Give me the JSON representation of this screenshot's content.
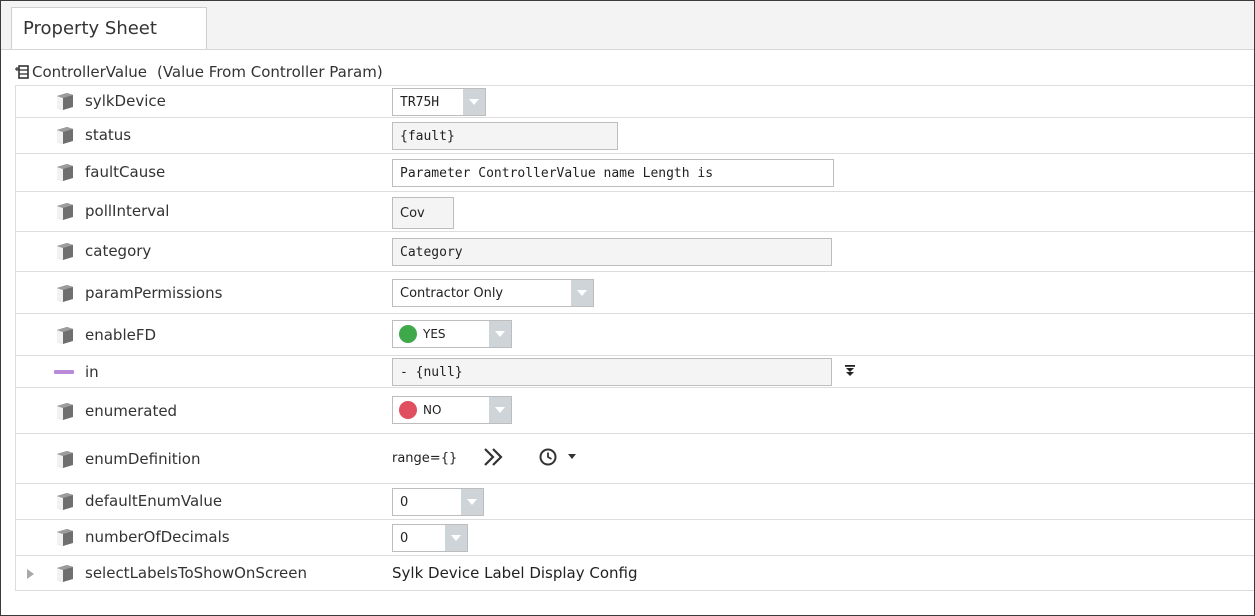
{
  "tab": {
    "label": "Property Sheet"
  },
  "root": {
    "name": "ControllerValue",
    "note": "(Value From Controller Param)",
    "icon": "component-plus-icon"
  },
  "properties": [
    {
      "name": "sylkDevice",
      "value": "TR75H",
      "kind": "dropdown"
    },
    {
      "name": "status",
      "value": "{fault}",
      "kind": "readonly"
    },
    {
      "name": "faultCause",
      "value": "Parameter ControllerValue name Length is",
      "kind": "text"
    },
    {
      "name": "pollInterval",
      "value": "Cov",
      "kind": "readonly"
    },
    {
      "name": "category",
      "value": "Category",
      "kind": "readonly"
    },
    {
      "name": "paramPermissions",
      "value": "Contractor Only",
      "kind": "dropdown"
    },
    {
      "name": "enableFD",
      "value": "YES",
      "kind": "bool",
      "color": "#3ea84a"
    },
    {
      "name": "in",
      "value": "- {null}",
      "kind": "slot"
    },
    {
      "name": "enumerated",
      "value": "NO",
      "kind": "bool",
      "color": "#e04f5f"
    },
    {
      "name": "enumDefinition",
      "value": "range={}",
      "kind": "enum"
    },
    {
      "name": "defaultEnumValue",
      "value": "0",
      "kind": "dropdown"
    },
    {
      "name": "numberOfDecimals",
      "value": "0",
      "kind": "dropdown"
    },
    {
      "name": "selectLabelsToShowOnScreen",
      "value": "Sylk Device Label Display Config",
      "kind": "plain"
    }
  ],
  "icons": {
    "property": "property-cube-icon",
    "link": "link-slot-icon",
    "expand": "expand-arrow-icon",
    "more": "double-chevron-right-icon",
    "history": "clock-history-icon",
    "menu": "caret-down-icon",
    "slot_menu": "double-arrow-down-icon"
  },
  "colors": {
    "yes": "#3ea84a",
    "no": "#e04f5f",
    "link": "#b98ad8",
    "dropdown": "#cfd4d8"
  }
}
